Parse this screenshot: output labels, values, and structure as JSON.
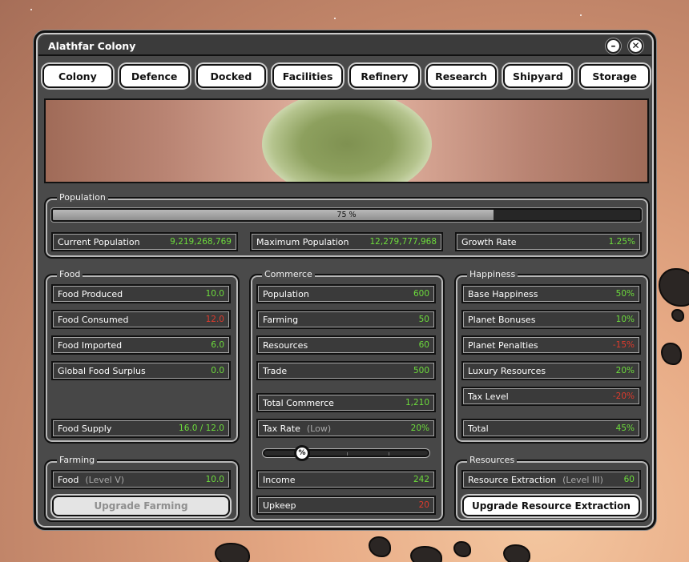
{
  "window": {
    "title": "Alathfar Colony"
  },
  "tabs": [
    "Colony",
    "Defence",
    "Docked",
    "Facilities",
    "Refinery",
    "Research",
    "Shipyard",
    "Storage"
  ],
  "population": {
    "label": "Population",
    "progress_percent": 75,
    "progress_text": "75 %",
    "current": {
      "label": "Current Population",
      "value": "9,219,268,769"
    },
    "maximum": {
      "label": "Maximum Population",
      "value": "12,279,777,968"
    },
    "growth": {
      "label": "Growth Rate",
      "value": "1.25%"
    }
  },
  "food": {
    "label": "Food",
    "produced": {
      "label": "Food Produced",
      "value": "10.0"
    },
    "consumed": {
      "label": "Food Consumed",
      "value": "12.0"
    },
    "imported": {
      "label": "Food Imported",
      "value": "6.0"
    },
    "surplus": {
      "label": "Global Food Surplus",
      "value": "0.0"
    },
    "supply": {
      "label": "Food Supply",
      "value": "16.0 / 12.0"
    }
  },
  "farming": {
    "label": "Farming",
    "food": {
      "label": "Food",
      "level": "(Level V)",
      "value": "10.0"
    },
    "upgrade_label": "Upgrade Farming"
  },
  "commerce": {
    "label": "Commerce",
    "population": {
      "label": "Population",
      "value": "600"
    },
    "farming": {
      "label": "Farming",
      "value": "50"
    },
    "resources": {
      "label": "Resources",
      "value": "60"
    },
    "trade": {
      "label": "Trade",
      "value": "500"
    },
    "total": {
      "label": "Total Commerce",
      "value": "1,210"
    },
    "tax_rate": {
      "label": "Tax Rate",
      "level": "(Low)",
      "value": "20%"
    },
    "tax_slider_icon": "%",
    "tax_slider_level": 0.2,
    "income": {
      "label": "Income",
      "value": "242"
    },
    "upkeep": {
      "label": "Upkeep",
      "value": "20"
    }
  },
  "happiness": {
    "label": "Happiness",
    "base": {
      "label": "Base Happiness",
      "value": "50%"
    },
    "bonuses": {
      "label": "Planet Bonuses",
      "value": "10%"
    },
    "penalties": {
      "label": "Planet Penalties",
      "value": "-15%"
    },
    "luxury": {
      "label": "Luxury Resources",
      "value": "20%"
    },
    "tax": {
      "label": "Tax Level",
      "value": "-20%"
    },
    "total": {
      "label": "Total",
      "value": "45%"
    }
  },
  "resources": {
    "label": "Resources",
    "extraction": {
      "label": "Resource Extraction",
      "level": "(Level III)",
      "value": "60"
    },
    "upgrade_label": "Upgrade Resource Extraction"
  },
  "colors": {
    "positive": "#6ddc3c",
    "negative": "#e03a2c",
    "panel": "#4a4a4a"
  },
  "icons": {
    "minimize": "minimize-icon",
    "close": "close-icon",
    "slider": "percent-icon"
  }
}
